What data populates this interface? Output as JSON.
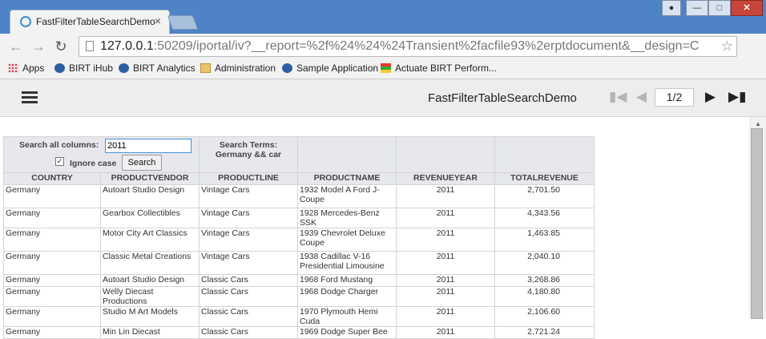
{
  "browser": {
    "tab_title": "FastFilterTableSearchDemo",
    "tab_close": "×",
    "url_host": "127.0.0.1",
    "url_rest": ":50209/iportal/iv?__report=%2f%24%24%24Transient%2facfile93%2erptdocument&__design=C",
    "bookmarks": [
      "Apps",
      "BIRT iHub",
      "BIRT Analytics",
      "Administration",
      "Sample Application",
      "Actuate BIRT Perform..."
    ]
  },
  "app": {
    "report_title": "FastFilterTableSearchDemo",
    "page_indicator": "1/2"
  },
  "search": {
    "label": "Search all columns:",
    "value": "2011",
    "ignore_case_label": "Ignore case",
    "ignore_case_checked": true,
    "button_label": "Search",
    "terms_label": "Search Terms:",
    "terms_value": "Germany && car"
  },
  "table": {
    "columns": [
      "COUNTRY",
      "PRODUCTVENDOR",
      "PRODUCTLINE",
      "PRODUCTNAME",
      "REVENUEYEAR",
      "TOTALREVENUE"
    ],
    "rows": [
      [
        "Germany",
        "Autoart Studio Design",
        "Vintage Cars",
        "1932 Model A Ford J-Coupe",
        "2011",
        "2,701.50"
      ],
      [
        "Germany",
        "Gearbox Collectibles",
        "Vintage Cars",
        "1928 Mercedes-Benz SSK",
        "2011",
        "4,343.56"
      ],
      [
        "Germany",
        "Motor City Art Classics",
        "Vintage Cars",
        "1939 Chevrolet Deluxe Coupe",
        "2011",
        "1,463.85"
      ],
      [
        "Germany",
        "Classic Metal Creations",
        "Vintage Cars",
        "1938 Cadillac V-16 Presidential Limousine",
        "2011",
        "2,040.10"
      ],
      [
        "Germany",
        "Autoart Studio Design",
        "Classic Cars",
        "1968 Ford Mustang",
        "2011",
        "3,268.86"
      ],
      [
        "Germany",
        "Welly Diecast Productions",
        "Classic Cars",
        "1968 Dodge Charger",
        "2011",
        "4,180.80"
      ],
      [
        "Germany",
        "Studio M Art Models",
        "Classic Cars",
        "1970 Plymouth Hemi Cuda",
        "2011",
        "2,106.60"
      ],
      [
        "Germany",
        "Min Lin Diecast",
        "Classic Cars",
        "1969 Dodge Super Bee",
        "2011",
        "2,721.24"
      ]
    ]
  }
}
